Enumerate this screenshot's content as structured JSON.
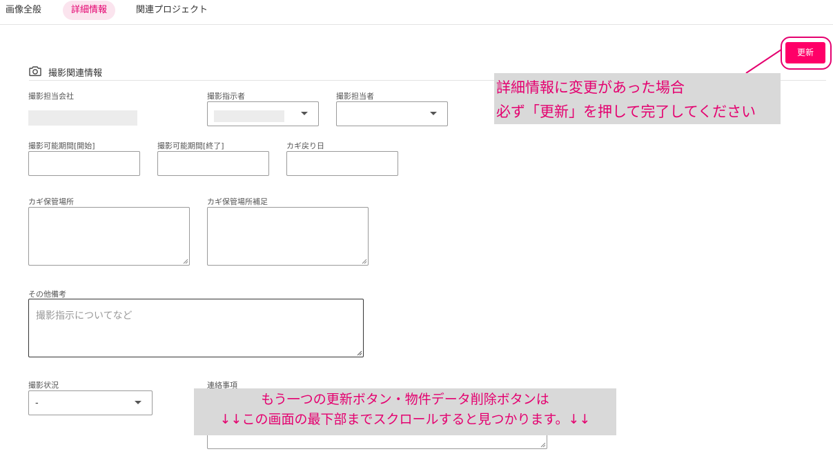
{
  "tabs": [
    {
      "label": "画像全般",
      "active": false
    },
    {
      "label": "詳細情報",
      "active": true
    },
    {
      "label": "関連プロジェクト",
      "active": false
    }
  ],
  "update_button": {
    "label": "更新"
  },
  "section": {
    "title": "撮影関連情報",
    "icon": "camera-icon"
  },
  "fields": {
    "company": {
      "label": "撮影担当会社"
    },
    "director": {
      "label": "撮影指示者"
    },
    "photographer": {
      "label": "撮影担当者"
    },
    "period_start": {
      "label": "撮影可能期間[開始]"
    },
    "period_end": {
      "label": "撮影可能期間[終了]"
    },
    "key_return": {
      "label": "カギ戻り日"
    },
    "key_location": {
      "label": "カギ保管場所"
    },
    "key_location_note": {
      "label": "カギ保管場所補足"
    },
    "other_notes": {
      "label": "その他備考",
      "placeholder": "撮影指示についてなど"
    },
    "status": {
      "label": "撮影状況",
      "value": "-"
    },
    "contact": {
      "label": "連絡事項"
    }
  },
  "annotations": {
    "update_note": {
      "line1": "詳細情報に変更があった場合",
      "line2": "必ず「更新」を押して完了してください"
    },
    "scroll_note": {
      "line1": "もう一つの更新ボタン・物件データ削除ボタンは",
      "line2": "↓↓この画面の最下部までスクロールすると見つかります。↓↓"
    }
  },
  "colors": {
    "accent": "#ff0068",
    "annotation_text": "#e4006f",
    "annotation_bg": "#d9d9d9",
    "active_tab_bg": "#fbe4ee"
  }
}
